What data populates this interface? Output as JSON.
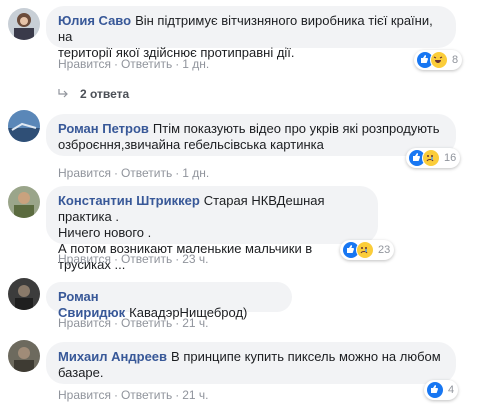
{
  "comments": [
    {
      "author": "Юлия Саво",
      "lines": [
        "Він підтримує вітчизняного виробника тієї країни, на",
        "території якої здійснює протиправні дії."
      ],
      "like": "Нравится",
      "reply": "Ответить",
      "time": "1 дн.",
      "count": "8",
      "reactions": [
        "like-icon",
        "haha-icon"
      ]
    },
    {
      "author": "Роман Петров",
      "lines": [
        "Птім показують відео про укрів які розпродують",
        "озброєння,звичайна гебельсівська картинка"
      ],
      "like": "Нравится",
      "reply": "Ответить",
      "time": "1 дн.",
      "count": "16",
      "reactions": [
        "like-icon",
        "sad-icon"
      ]
    },
    {
      "author": "Константин Штриккер",
      "lines": [
        "Старая НКВДешная практика .",
        "Ничего нового .",
        "А потом возникают маленькие мальчики в трусиках ..."
      ],
      "like": "Нравится",
      "reply": "Ответить",
      "time": "23 ч.",
      "count": "23",
      "reactions": [
        "like-icon",
        "sad-icon"
      ]
    },
    {
      "author": "Роман Свиридюк",
      "lines": [
        "КавадэрНищеброд)"
      ],
      "like": "Нравится",
      "reply": "Ответить",
      "time": "21 ч."
    },
    {
      "author": "Михаил Андреев",
      "lines": [
        "В принципе купить пиксель можно на любом",
        "базаре."
      ],
      "like": "Нравится",
      "reply": "Ответить",
      "time": "21 ч.",
      "count": "4",
      "reactions": [
        "like-icon"
      ]
    }
  ],
  "replies_link": "2 ответа",
  "colors": {
    "author": "#385898",
    "bubble": "#f2f3f5",
    "like": "#1877f2",
    "emoji": "#fbcd3a"
  }
}
